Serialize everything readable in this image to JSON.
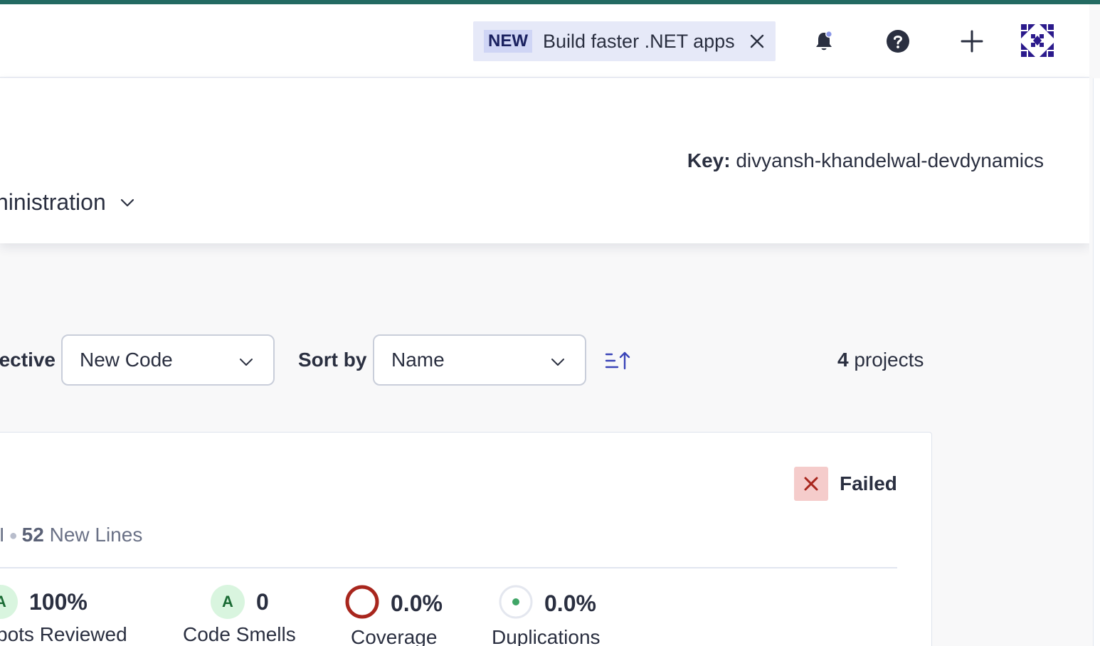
{
  "topbar": {
    "promo": {
      "badge": "NEW",
      "text": "Build faster .NET apps",
      "close_icon": "close-icon"
    },
    "icons": [
      "bell-icon",
      "help-icon",
      "plus-icon",
      "avatar"
    ]
  },
  "header": {
    "key_label": "Key:",
    "key_value": "divyansh-khandelwal-devdynamics",
    "nav_admin": "ninistration"
  },
  "filters": {
    "perspective_label": "ective",
    "perspective_value": "New Code",
    "sort_label": "Sort by",
    "sort_value": "Name",
    "count_number": "4",
    "count_text": "projects"
  },
  "project_card": {
    "status": "Failed",
    "meta_prefix": "/I",
    "new_lines_count": "52",
    "new_lines_label": "New Lines",
    "metrics": [
      {
        "rating": "A",
        "value": "100%",
        "label": "pots Reviewed"
      },
      {
        "rating": "A",
        "value": "0",
        "label": "Code Smells"
      },
      {
        "value": "0.0%",
        "label": "Coverage"
      },
      {
        "value": "0.0%",
        "label": "Duplications"
      }
    ]
  },
  "colors": {
    "accent": "#236a62",
    "failed_bg": "#f5cccb",
    "failed_mark": "#a8261d",
    "rating_bg": "#d9f5df",
    "coverage_ring": "#a8261d",
    "duplication_dot": "#3fa566"
  }
}
